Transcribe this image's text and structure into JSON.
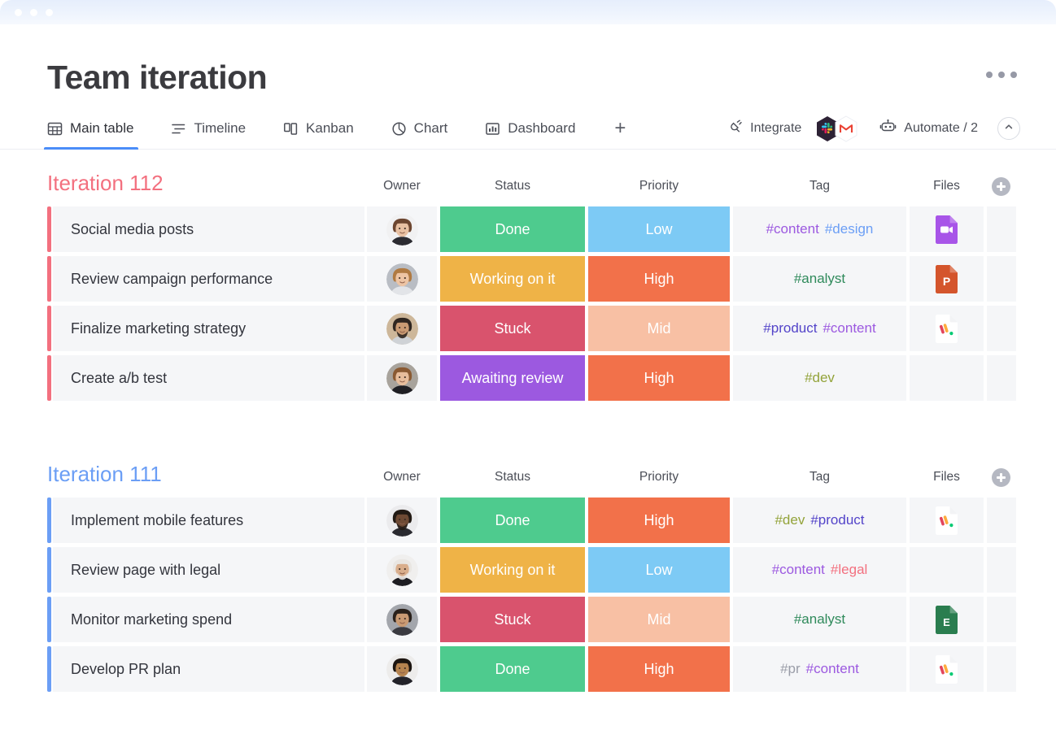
{
  "window": {
    "dots": [
      "close",
      "minimize",
      "maximize"
    ]
  },
  "header": {
    "title": "Team iteration",
    "menu_icon": "more-options-icon"
  },
  "tabs": [
    {
      "label": "Main table",
      "icon": "table-icon",
      "active": true
    },
    {
      "label": "Timeline",
      "icon": "timeline-icon",
      "active": false
    },
    {
      "label": "Kanban",
      "icon": "kanban-icon",
      "active": false
    },
    {
      "label": "Chart",
      "icon": "pie-chart-icon",
      "active": false
    },
    {
      "label": "Dashboard",
      "icon": "bar-chart-icon",
      "active": false
    }
  ],
  "add_tab_label": "+",
  "tools": {
    "integrate_label": "Integrate",
    "integrate_icon": "plug-icon",
    "integration_logos": [
      "slack-logo",
      "gmail-logo"
    ],
    "automate_label": "Automate / 2",
    "automate_icon": "robot-icon",
    "collapse_icon": "chevron-up-icon"
  },
  "columns": [
    "Owner",
    "Status",
    "Priority",
    "Tag",
    "Files"
  ],
  "add_column_icon": "plus-circle-icon",
  "colors": {
    "done": "#4ecb8e",
    "working_on_it": "#efb347",
    "stuck": "#d9536d",
    "awaiting_review": "#9c59e0",
    "high": "#f2714a",
    "mid": "#f8c0a4",
    "low": "#7dcaf5",
    "group_112": "#f3707f",
    "group_111": "#6b9ef5",
    "cell_bg": "#f5f6f8",
    "accent": "#4b8df8"
  },
  "tag_colors": {
    "#content": "#9c59e0",
    "#design": "#6b9ef5",
    "#analyst": "#2f8a5b",
    "#product": "#5344c9",
    "#dev": "#93a33a",
    "#legal": "#f3707f",
    "#pr": "#9a9da8"
  },
  "groups": [
    {
      "title": "Iteration 112",
      "color": "#f3707f",
      "rows": [
        {
          "name": "Social media posts",
          "owner": "avatar-woman-1",
          "status": {
            "label": "Done",
            "color": "#4ecb8e"
          },
          "priority": {
            "label": "Low",
            "color": "#7dcaf5"
          },
          "tags": [
            "#content",
            "#design"
          ],
          "file": "video-file"
        },
        {
          "name": "Review campaign performance",
          "owner": "avatar-woman-2",
          "status": {
            "label": "Working on it",
            "color": "#efb347"
          },
          "priority": {
            "label": "High",
            "color": "#f2714a"
          },
          "tags": [
            "#analyst"
          ],
          "file": "powerpoint-file"
        },
        {
          "name": "Finalize marketing strategy",
          "owner": "avatar-man-1",
          "status": {
            "label": "Stuck",
            "color": "#d9536d"
          },
          "priority": {
            "label": "Mid",
            "color": "#f8c0a4"
          },
          "tags": [
            "#product",
            "#content"
          ],
          "file": "monday-file"
        },
        {
          "name": "Create a/b test",
          "owner": "avatar-woman-3",
          "status": {
            "label": "Awaiting review",
            "color": "#9c59e0"
          },
          "priority": {
            "label": "High",
            "color": "#f2714a"
          },
          "tags": [
            "#dev"
          ],
          "file": ""
        }
      ]
    },
    {
      "title": "Iteration 111",
      "color": "#6b9ef5",
      "rows": [
        {
          "name": "Implement mobile features",
          "owner": "avatar-man-2",
          "status": {
            "label": "Done",
            "color": "#4ecb8e"
          },
          "priority": {
            "label": "High",
            "color": "#f2714a"
          },
          "tags": [
            "#dev",
            "#product"
          ],
          "file": "monday-file"
        },
        {
          "name": "Review page with legal",
          "owner": "avatar-man-3",
          "status": {
            "label": "Working on it",
            "color": "#efb347"
          },
          "priority": {
            "label": "Low",
            "color": "#7dcaf5"
          },
          "tags": [
            "#content",
            "#legal"
          ],
          "file": ""
        },
        {
          "name": "Monitor marketing spend",
          "owner": "avatar-woman-4",
          "status": {
            "label": "Stuck",
            "color": "#d9536d"
          },
          "priority": {
            "label": "Mid",
            "color": "#f8c0a4"
          },
          "tags": [
            "#analyst"
          ],
          "file": "excel-file"
        },
        {
          "name": "Develop PR plan",
          "owner": "avatar-woman-5",
          "status": {
            "label": "Done",
            "color": "#4ecb8e"
          },
          "priority": {
            "label": "High",
            "color": "#f2714a"
          },
          "tags": [
            "#pr",
            "#content"
          ],
          "file": "monday-file"
        }
      ]
    }
  ]
}
